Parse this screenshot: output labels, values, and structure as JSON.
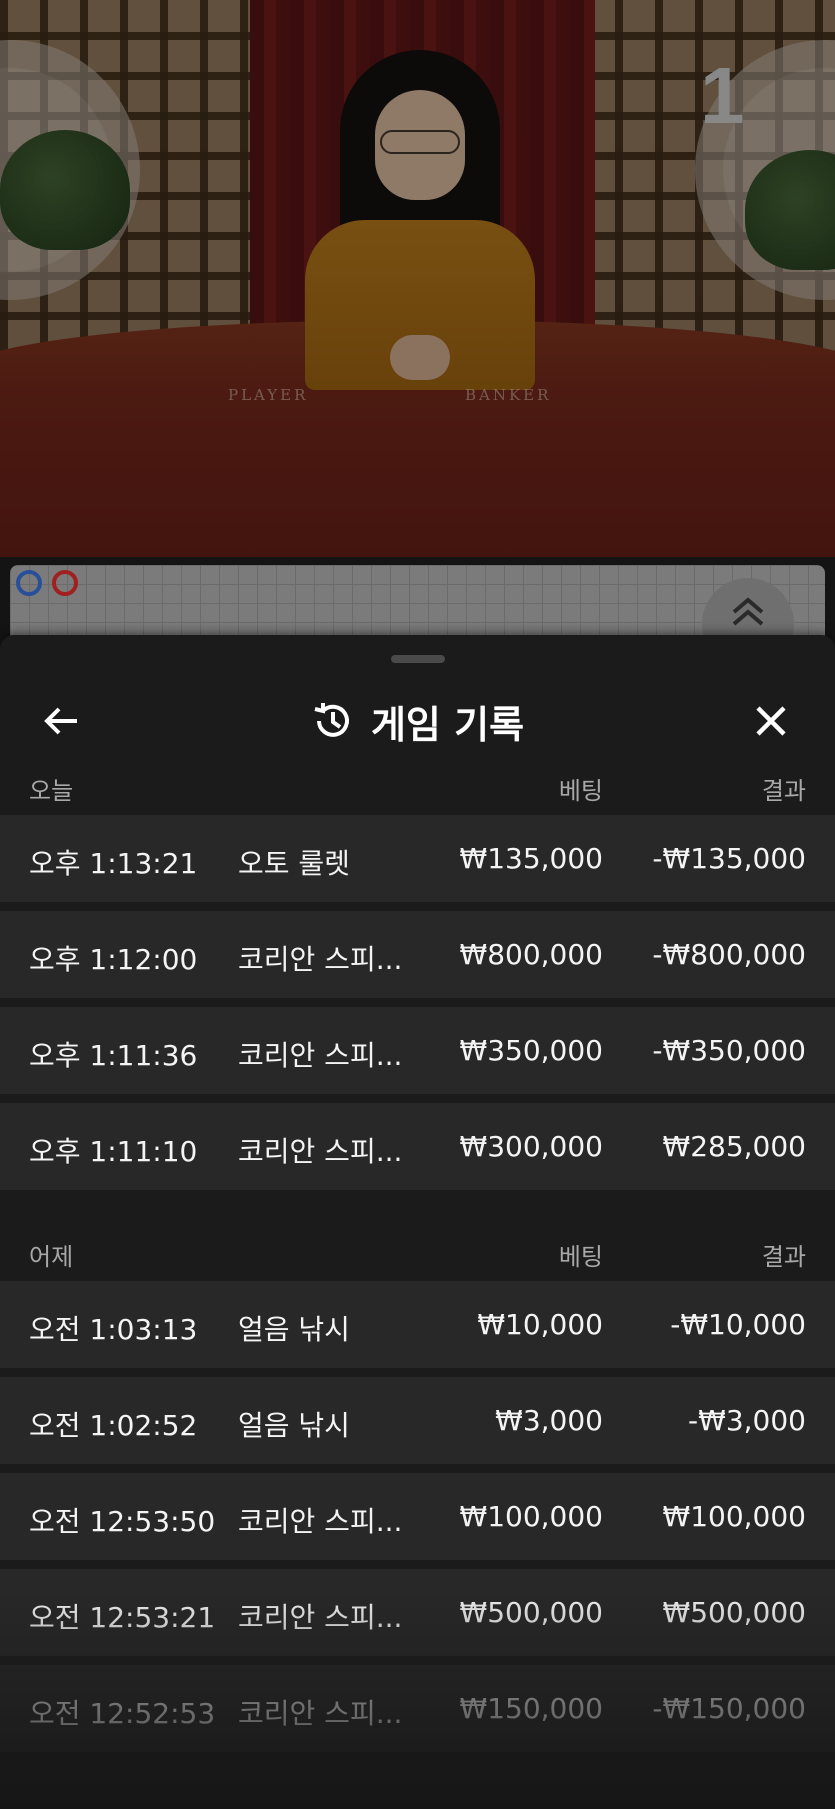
{
  "video": {
    "round_number": "1",
    "table_label_player": "PLAYER",
    "table_label_banker": "BANKER"
  },
  "roadmap": {
    "dots": [
      {
        "color": "#2f5fd0"
      },
      {
        "color": "#d02a2a"
      }
    ],
    "expand_icon": "double-chevron-up-icon"
  },
  "sheet": {
    "title": "게임 기록",
    "back_icon": "arrow-left-icon",
    "history_icon": "history-icon",
    "close_icon": "close-icon",
    "sections": [
      {
        "label": "오늘",
        "bet_header": "베팅",
        "result_header": "결과",
        "rows": [
          {
            "time": "오후 1:13:21",
            "game": "오토 룰렛",
            "bet": "₩135,000",
            "result": "-₩135,000"
          },
          {
            "time": "오후 1:12:00",
            "game": "코리안 스피...",
            "bet": "₩800,000",
            "result": "-₩800,000"
          },
          {
            "time": "오후 1:11:36",
            "game": "코리안 스피...",
            "bet": "₩350,000",
            "result": "-₩350,000"
          },
          {
            "time": "오후 1:11:10",
            "game": "코리안 스피...",
            "bet": "₩300,000",
            "result": "₩285,000"
          }
        ]
      },
      {
        "label": "어제",
        "bet_header": "베팅",
        "result_header": "결과",
        "rows": [
          {
            "time": "오전 1:03:13",
            "game": "얼음 낚시",
            "bet": "₩10,000",
            "result": "-₩10,000"
          },
          {
            "time": "오전 1:02:52",
            "game": "얼음 낚시",
            "bet": "₩3,000",
            "result": "-₩3,000"
          },
          {
            "time": "오전 12:53:50",
            "game": "코리안 스피...",
            "bet": "₩100,000",
            "result": "₩100,000"
          },
          {
            "time": "오전 12:53:21",
            "game": "코리안 스피...",
            "bet": "₩500,000",
            "result": "₩500,000"
          },
          {
            "time": "오전 12:52:53",
            "game": "코리안 스피...",
            "bet": "₩150,000",
            "result": "-₩150,000"
          }
        ]
      }
    ]
  },
  "colors": {
    "sheet_bg": "#1b1b1b",
    "row_bg": "#282828",
    "header_text": "#a8a8a8"
  }
}
